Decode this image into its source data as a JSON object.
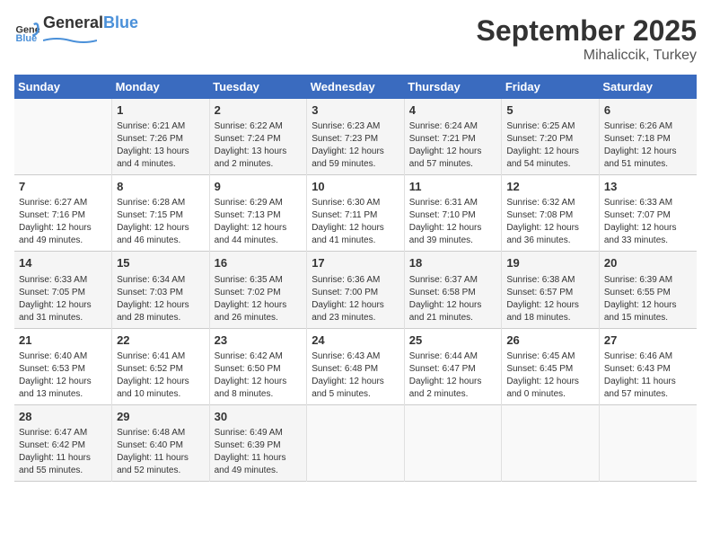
{
  "header": {
    "logo_general": "General",
    "logo_blue": "Blue",
    "title": "September 2025",
    "subtitle": "Mihaliccik, Turkey"
  },
  "days_of_week": [
    "Sunday",
    "Monday",
    "Tuesday",
    "Wednesday",
    "Thursday",
    "Friday",
    "Saturday"
  ],
  "weeks": [
    [
      {
        "day": "",
        "info": ""
      },
      {
        "day": "1",
        "info": "Sunrise: 6:21 AM\nSunset: 7:26 PM\nDaylight: 13 hours\nand 4 minutes."
      },
      {
        "day": "2",
        "info": "Sunrise: 6:22 AM\nSunset: 7:24 PM\nDaylight: 13 hours\nand 2 minutes."
      },
      {
        "day": "3",
        "info": "Sunrise: 6:23 AM\nSunset: 7:23 PM\nDaylight: 12 hours\nand 59 minutes."
      },
      {
        "day": "4",
        "info": "Sunrise: 6:24 AM\nSunset: 7:21 PM\nDaylight: 12 hours\nand 57 minutes."
      },
      {
        "day": "5",
        "info": "Sunrise: 6:25 AM\nSunset: 7:20 PM\nDaylight: 12 hours\nand 54 minutes."
      },
      {
        "day": "6",
        "info": "Sunrise: 6:26 AM\nSunset: 7:18 PM\nDaylight: 12 hours\nand 51 minutes."
      }
    ],
    [
      {
        "day": "7",
        "info": "Sunrise: 6:27 AM\nSunset: 7:16 PM\nDaylight: 12 hours\nand 49 minutes."
      },
      {
        "day": "8",
        "info": "Sunrise: 6:28 AM\nSunset: 7:15 PM\nDaylight: 12 hours\nand 46 minutes."
      },
      {
        "day": "9",
        "info": "Sunrise: 6:29 AM\nSunset: 7:13 PM\nDaylight: 12 hours\nand 44 minutes."
      },
      {
        "day": "10",
        "info": "Sunrise: 6:30 AM\nSunset: 7:11 PM\nDaylight: 12 hours\nand 41 minutes."
      },
      {
        "day": "11",
        "info": "Sunrise: 6:31 AM\nSunset: 7:10 PM\nDaylight: 12 hours\nand 39 minutes."
      },
      {
        "day": "12",
        "info": "Sunrise: 6:32 AM\nSunset: 7:08 PM\nDaylight: 12 hours\nand 36 minutes."
      },
      {
        "day": "13",
        "info": "Sunrise: 6:33 AM\nSunset: 7:07 PM\nDaylight: 12 hours\nand 33 minutes."
      }
    ],
    [
      {
        "day": "14",
        "info": "Sunrise: 6:33 AM\nSunset: 7:05 PM\nDaylight: 12 hours\nand 31 minutes."
      },
      {
        "day": "15",
        "info": "Sunrise: 6:34 AM\nSunset: 7:03 PM\nDaylight: 12 hours\nand 28 minutes."
      },
      {
        "day": "16",
        "info": "Sunrise: 6:35 AM\nSunset: 7:02 PM\nDaylight: 12 hours\nand 26 minutes."
      },
      {
        "day": "17",
        "info": "Sunrise: 6:36 AM\nSunset: 7:00 PM\nDaylight: 12 hours\nand 23 minutes."
      },
      {
        "day": "18",
        "info": "Sunrise: 6:37 AM\nSunset: 6:58 PM\nDaylight: 12 hours\nand 21 minutes."
      },
      {
        "day": "19",
        "info": "Sunrise: 6:38 AM\nSunset: 6:57 PM\nDaylight: 12 hours\nand 18 minutes."
      },
      {
        "day": "20",
        "info": "Sunrise: 6:39 AM\nSunset: 6:55 PM\nDaylight: 12 hours\nand 15 minutes."
      }
    ],
    [
      {
        "day": "21",
        "info": "Sunrise: 6:40 AM\nSunset: 6:53 PM\nDaylight: 12 hours\nand 13 minutes."
      },
      {
        "day": "22",
        "info": "Sunrise: 6:41 AM\nSunset: 6:52 PM\nDaylight: 12 hours\nand 10 minutes."
      },
      {
        "day": "23",
        "info": "Sunrise: 6:42 AM\nSunset: 6:50 PM\nDaylight: 12 hours\nand 8 minutes."
      },
      {
        "day": "24",
        "info": "Sunrise: 6:43 AM\nSunset: 6:48 PM\nDaylight: 12 hours\nand 5 minutes."
      },
      {
        "day": "25",
        "info": "Sunrise: 6:44 AM\nSunset: 6:47 PM\nDaylight: 12 hours\nand 2 minutes."
      },
      {
        "day": "26",
        "info": "Sunrise: 6:45 AM\nSunset: 6:45 PM\nDaylight: 12 hours\nand 0 minutes."
      },
      {
        "day": "27",
        "info": "Sunrise: 6:46 AM\nSunset: 6:43 PM\nDaylight: 11 hours\nand 57 minutes."
      }
    ],
    [
      {
        "day": "28",
        "info": "Sunrise: 6:47 AM\nSunset: 6:42 PM\nDaylight: 11 hours\nand 55 minutes."
      },
      {
        "day": "29",
        "info": "Sunrise: 6:48 AM\nSunset: 6:40 PM\nDaylight: 11 hours\nand 52 minutes."
      },
      {
        "day": "30",
        "info": "Sunrise: 6:49 AM\nSunset: 6:39 PM\nDaylight: 11 hours\nand 49 minutes."
      },
      {
        "day": "",
        "info": ""
      },
      {
        "day": "",
        "info": ""
      },
      {
        "day": "",
        "info": ""
      },
      {
        "day": "",
        "info": ""
      }
    ]
  ]
}
